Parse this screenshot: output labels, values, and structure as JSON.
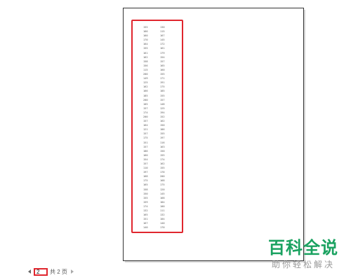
{
  "document": {
    "rows": [
      [
        "155",
        "130"
      ],
      [
        "166",
        "115"
      ],
      [
        "160",
        "167"
      ],
      [
        "170",
        "145"
      ],
      [
        "164",
        "172"
      ],
      [
        "155",
        "161"
      ],
      [
        "161",
        "179"
      ],
      [
        "162",
        "154"
      ],
      [
        "158",
        "157"
      ],
      [
        "156",
        "165"
      ],
      [
        "115",
        "160"
      ],
      [
        "200",
        "155"
      ],
      [
        "149",
        "171"
      ],
      [
        "125",
        "191"
      ],
      [
        "162",
        "175"
      ],
      [
        "166",
        "185"
      ],
      [
        "185",
        "155"
      ],
      [
        "200",
        "157"
      ],
      [
        "105",
        "148"
      ],
      [
        "157",
        "125"
      ],
      [
        "174",
        "194"
      ],
      [
        "200",
        "152"
      ],
      [
        "157",
        "162"
      ],
      [
        "164",
        "150"
      ],
      [
        "121",
        "186"
      ],
      [
        "157",
        "155"
      ],
      [
        "175",
        "197"
      ],
      [
        "151",
        "116"
      ],
      [
        "157",
        "163"
      ],
      [
        "186",
        "150"
      ],
      [
        "160",
        "155"
      ],
      [
        "154",
        "174"
      ],
      [
        "157",
        "162"
      ],
      [
        "110",
        "155"
      ],
      [
        "197",
        "176"
      ],
      [
        "168",
        "200"
      ],
      [
        "175",
        "168"
      ],
      [
        "165",
        "175"
      ],
      [
        "158",
        "120"
      ],
      [
        "150",
        "145"
      ],
      [
        "155",
        "168"
      ],
      [
        "159",
        "184"
      ],
      [
        "174",
        "100"
      ],
      [
        "132",
        "111"
      ],
      [
        "165",
        "132"
      ],
      [
        "151",
        "104"
      ],
      [
        "167",
        "140"
      ],
      [
        "140",
        "170"
      ]
    ]
  },
  "pager": {
    "current_page": "2",
    "total_label": "共 2 页"
  },
  "watermark": {
    "title": "百科全说",
    "subtitle": "助你轻松解决"
  },
  "colors": {
    "highlight": "#e0262e",
    "watermark": "#1aa260"
  },
  "icons": {
    "prev": "triangle-left",
    "next": "triangle-right"
  }
}
